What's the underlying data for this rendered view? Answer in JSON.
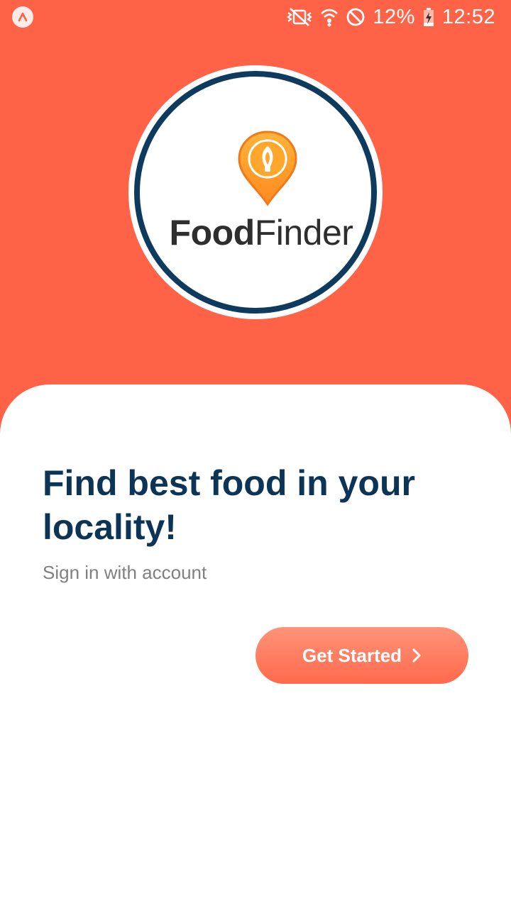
{
  "status_bar": {
    "battery_percent": "12%",
    "time": "12:52",
    "icons": [
      "app-badge-icon",
      "mute-vibrate-icon",
      "wifi-icon",
      "do-not-disturb-icon",
      "battery-charging-icon"
    ]
  },
  "logo": {
    "brand_part1": "Food",
    "brand_part2": "Finder",
    "pin_icon": "location-pin-icon"
  },
  "content": {
    "headline": "Find best food in your locality!",
    "subtext": "Sign in with account"
  },
  "cta": {
    "label": "Get Started",
    "icon": "chevron-right-icon"
  },
  "colors": {
    "header_bg": "#FF6347",
    "headline": "#0B3456",
    "ring": "#0E3A5E",
    "button_start": "#FF9378",
    "button_end": "#FF6A4D",
    "subtext": "#808080"
  }
}
